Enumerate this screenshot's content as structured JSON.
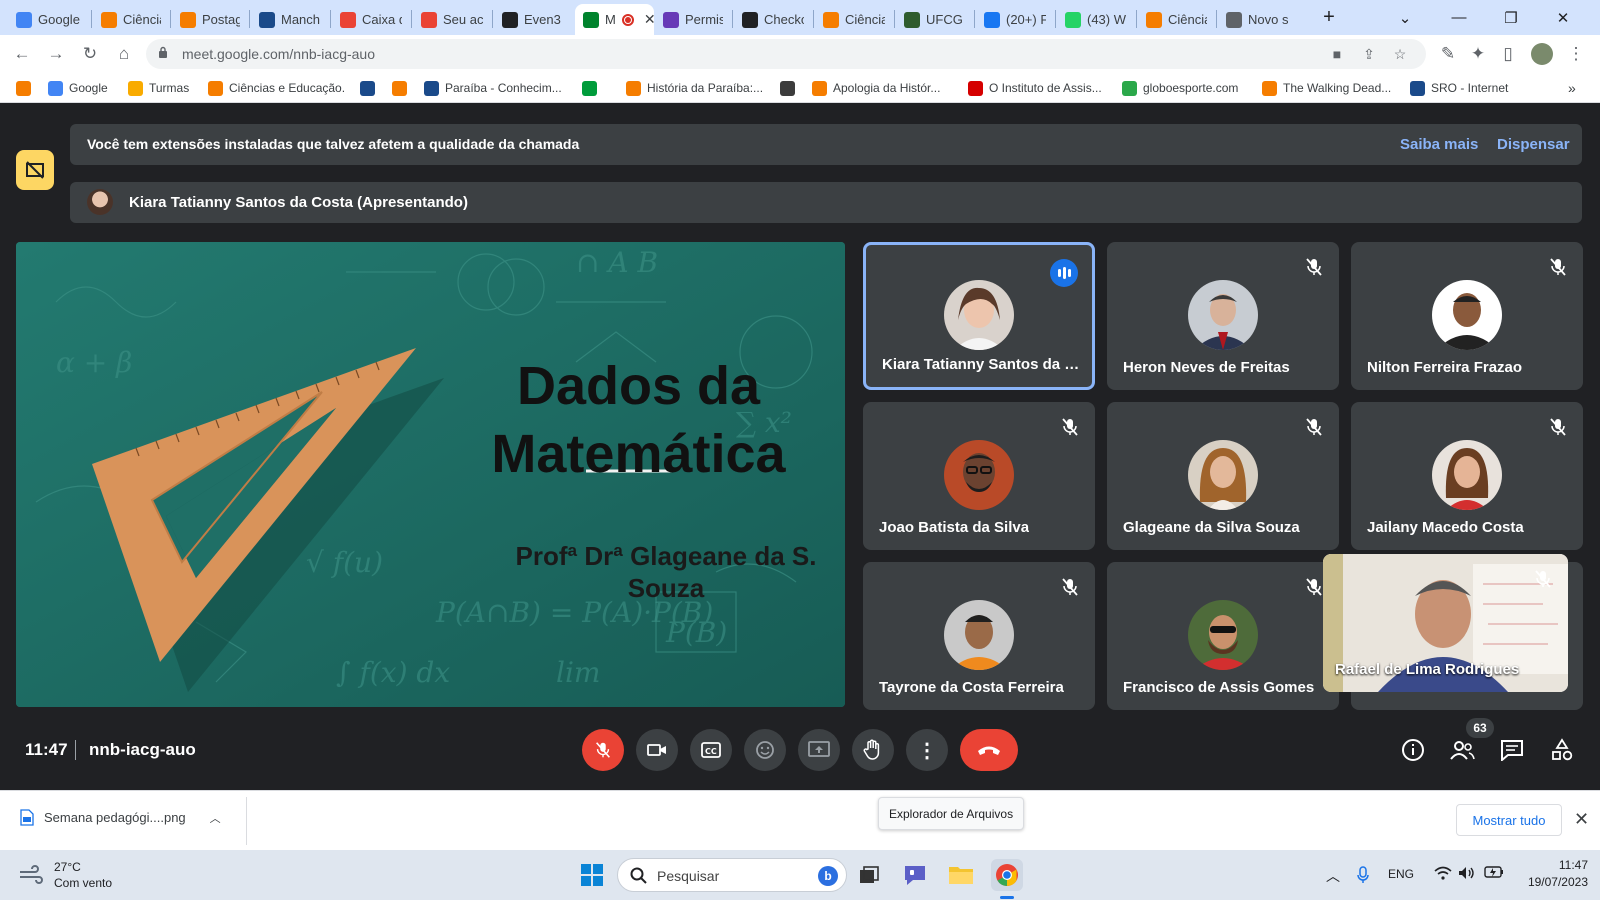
{
  "browser": {
    "tabs": [
      {
        "title": "Google",
        "icon": "google-icon",
        "color": "#4285f4"
      },
      {
        "title": "Ciência",
        "icon": "blogger-icon",
        "color": "#f57d00"
      },
      {
        "title": "Postag",
        "icon": "blogger-icon",
        "color": "#f57d00"
      },
      {
        "title": "Manch",
        "icon": "news-icon",
        "color": "#1a4a8a"
      },
      {
        "title": "Caixa d",
        "icon": "gmail-icon",
        "color": "#ea4335"
      },
      {
        "title": "Seu ac",
        "icon": "gmail-icon",
        "color": "#ea4335"
      },
      {
        "title": "Even3",
        "icon": "even3-icon",
        "color": "#202124"
      },
      {
        "title": "",
        "icon": "meet-icon",
        "color": "#00832d",
        "active": true
      },
      {
        "title": "Permis",
        "icon": "forms-icon",
        "color": "#673ab7"
      },
      {
        "title": "Checko",
        "icon": "even3-icon",
        "color": "#202124"
      },
      {
        "title": "Ciência",
        "icon": "blogger-icon",
        "color": "#f57d00"
      },
      {
        "title": "UFCG p",
        "icon": "ufcg-icon",
        "color": "#2e5c2e"
      },
      {
        "title": "(20+) F",
        "icon": "facebook-icon",
        "color": "#1877f2"
      },
      {
        "title": "(43) W",
        "icon": "whatsapp-icon",
        "color": "#25d366"
      },
      {
        "title": "Ciência",
        "icon": "blogger-icon",
        "color": "#f57d00"
      },
      {
        "title": "Novo s",
        "icon": "globe-icon",
        "color": "#5f6368"
      }
    ],
    "active_tab_letter": "M",
    "url": "meet.google.com/nnb-iacg-auo",
    "bookmarks": [
      {
        "label": "",
        "icon": "blogger-icon",
        "color": "#f57d00"
      },
      {
        "label": "Google",
        "icon": "google-icon",
        "color": "#4285f4"
      },
      {
        "label": "Turmas",
        "icon": "classroom-icon",
        "color": "#f9ab00"
      },
      {
        "label": "Ciências e Educação.",
        "icon": "blogger-icon",
        "color": "#f57d00"
      },
      {
        "label": "",
        "icon": "news-icon",
        "color": "#1a4a8a"
      },
      {
        "label": "",
        "icon": "blogger-icon",
        "color": "#f57d00"
      },
      {
        "label": "Paraíba - Conhecim...",
        "icon": "paraiba-icon",
        "color": "#1a4a8a"
      },
      {
        "label": "",
        "icon": "flag-icon",
        "color": "#009c3b"
      },
      {
        "label": "História da Paraíba:...",
        "icon": "blogger-icon",
        "color": "#f57d00"
      },
      {
        "label": "",
        "icon": "film-icon",
        "color": "#3c3c3c"
      },
      {
        "label": "Apologia da Histór...",
        "icon": "blogger-icon",
        "color": "#f57d00"
      },
      {
        "label": "O Instituto de Assis...",
        "icon": "red-square-icon",
        "color": "#d50000"
      },
      {
        "label": "globoesporte.com",
        "icon": "ge-icon",
        "color": "#2ba84a"
      },
      {
        "label": "The Walking Dead...",
        "icon": "blogger-icon",
        "color": "#f57d00"
      },
      {
        "label": "SRO - Internet",
        "icon": "sro-icon",
        "color": "#1a4a8a"
      }
    ]
  },
  "meet": {
    "banner_text": "Você tem extensões instaladas que talvez afetem a qualidade da chamada",
    "banner_learn_more": "Saiba mais",
    "banner_dismiss": "Dispensar",
    "presenter_text": "Kiara Tatianny Santos da Costa (Apresentando)",
    "slide": {
      "title_line1": "Dados da",
      "title_line2": "Matemática",
      "author_line1": "Profª Drª Glageane da S.",
      "author_line2": "Souza",
      "bg_color": "#1f6f66"
    },
    "participants": [
      {
        "name": "Kiara Tatianny Santos da C...",
        "speaking": true
      },
      {
        "name": "Heron Neves de Freitas",
        "muted": true
      },
      {
        "name": "Nilton Ferreira Frazao",
        "muted": true
      },
      {
        "name": "Joao Batista da Silva",
        "muted": true
      },
      {
        "name": "Glageane da Silva Souza",
        "muted": true
      },
      {
        "name": "Jailany Macedo Costa",
        "muted": true
      },
      {
        "name": "Tayrone da Costa Ferreira",
        "muted": true
      },
      {
        "name": "Francisco de Assis Gomes",
        "muted": true
      }
    ],
    "self_view_name": "Rafael de Lima Rodrigues",
    "time": "11:47",
    "meeting_code": "nnb-iacg-auo",
    "participant_count": "63",
    "accent_color": "#8ab4f8",
    "hangup_color": "#ea4335"
  },
  "downloads": {
    "file_name": "Semana pedagógi....png",
    "show_all": "Mostrar tudo",
    "tooltip": "Explorador de Arquivos"
  },
  "taskbar": {
    "temperature": "27°C",
    "weather": "Com vento",
    "search_placeholder": "Pesquisar",
    "language": "ENG",
    "time": "11:47",
    "date": "19/07/2023"
  }
}
